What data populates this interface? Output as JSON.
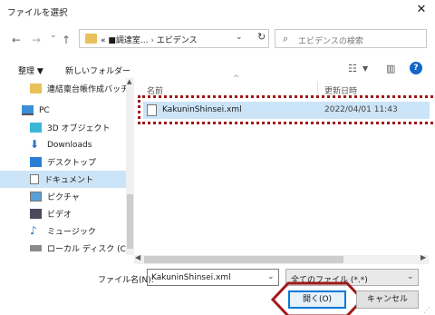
{
  "window": {
    "title": "ファイルを選択"
  },
  "nav": {
    "back": "←",
    "forward": "→",
    "recent": "⌄",
    "up": "↑"
  },
  "address": {
    "prefix": "«",
    "crumb1": "■調達室...",
    "sep": "›",
    "crumb2": "エビデンス"
  },
  "search": {
    "placeholder": "エビデンスの検索"
  },
  "toolbar": {
    "organize": "整理 ▼",
    "new_folder": "新しいフォルダー",
    "view_options": "▼"
  },
  "sidebar": {
    "items": [
      {
        "label": "連結稟台帳作成バッチ"
      },
      {
        "label": "PC"
      },
      {
        "label": "3D オブジェクト"
      },
      {
        "label": "Downloads"
      },
      {
        "label": "デスクトップ"
      },
      {
        "label": "ドキュメント"
      },
      {
        "label": "ピクチャ"
      },
      {
        "label": "ビデオ"
      },
      {
        "label": "ミュージック"
      },
      {
        "label": "ローカル ディスク (C:)"
      }
    ]
  },
  "columns": {
    "name": "名前",
    "modified": "更新日時"
  },
  "files": [
    {
      "name": "KakuninShinsei.xml",
      "modified": "2022/04/01 11:43"
    }
  ],
  "bottom": {
    "filename_label": "ファイル名(N):",
    "filename_value": "KakuninShinsei.xml",
    "filetype_value": "全てのファイル (*.*)",
    "open_label": "開く(O)",
    "cancel_label": "キャンセル"
  },
  "colors": {
    "accent": "#0078d7",
    "selection": "#cce4f7",
    "callout": "#a01818"
  }
}
